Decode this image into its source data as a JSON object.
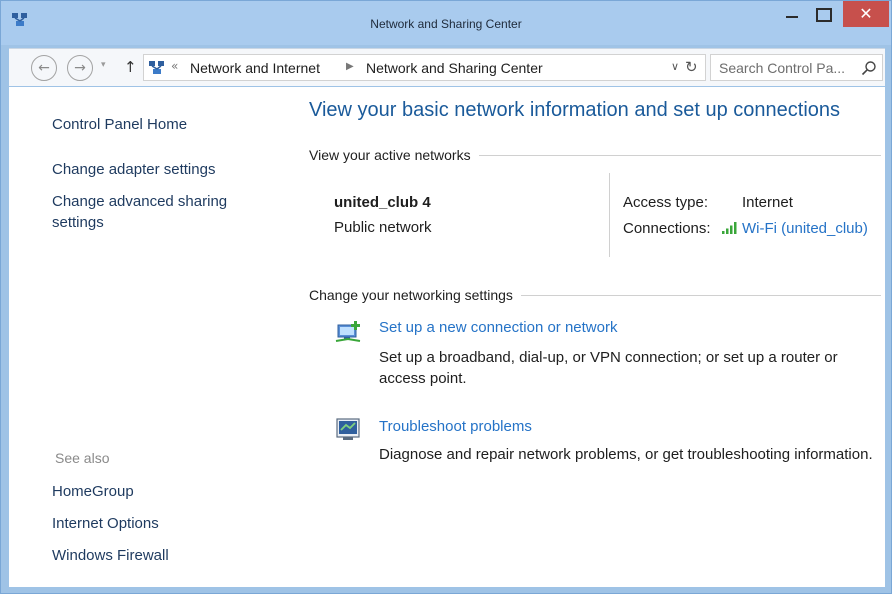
{
  "window": {
    "title": "Network and Sharing Center"
  },
  "toolbar": {
    "breadcrumb": [
      "Network and Internet",
      "Network and Sharing Center"
    ],
    "search_placeholder": "Search Control Pa..."
  },
  "sidebar": {
    "home_label": "Control Panel Home",
    "links": [
      "Change adapter settings",
      "Change advanced sharing settings"
    ],
    "see_also_label": "See also",
    "see_also_links": [
      "HomeGroup",
      "Internet Options",
      "Windows Firewall"
    ]
  },
  "main": {
    "title": "View your basic network information and set up connections",
    "active_networks_heading": "View your active networks",
    "network": {
      "name": "united_club  4",
      "category": "Public network",
      "access_type_label": "Access type:",
      "access_type_value": "Internet",
      "connections_label": "Connections:",
      "connection_link": "Wi-Fi (united_club)"
    },
    "change_settings_heading": "Change your networking settings",
    "tasks": [
      {
        "link": "Set up a new connection or network",
        "description": "Set up a broadband, dial-up, or VPN connection; or set up a router or access point."
      },
      {
        "link": "Troubleshoot problems",
        "description": "Diagnose and repair network problems, or get troubleshooting information."
      }
    ]
  },
  "colors": {
    "title_bar": "#a9cbee",
    "close_button": "#c7504c",
    "link": "#2573c7",
    "page_title": "#1a5a9a",
    "signal_green": "#3aa63a"
  },
  "icons": {
    "app": "network-center-icon",
    "search": "magnifier-icon",
    "wifi": "signal-bars-icon",
    "setup": "network-setup-icon",
    "troubleshoot": "troubleshoot-icon"
  }
}
